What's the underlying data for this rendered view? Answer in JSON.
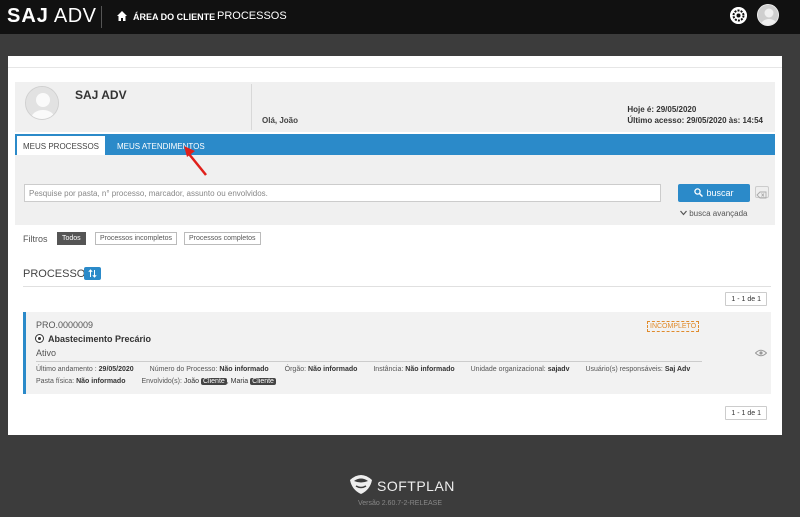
{
  "topbar": {
    "logo_bold": "SAJ",
    "logo_rest": "ADV",
    "area_label": "ÁREA DO CLIENTE",
    "processos_label": "PROCESSOS"
  },
  "header": {
    "client_name": "SAJ ADV",
    "greeting": "Olá, João",
    "today": "Hoje é: 29/05/2020",
    "last_access": "Último acesso: 29/05/2020 às: 14:54"
  },
  "tabs": [
    {
      "label": "MEUS PROCESSOS"
    },
    {
      "label": "MEUS ATENDIMENTOS"
    }
  ],
  "search": {
    "placeholder": "Pesquise por pasta, n° processo, marcador, assunto ou envolvidos.",
    "button_label": "buscar",
    "advanced_label": "busca avançada"
  },
  "filters": {
    "label": "Filtros",
    "chips": [
      "Todos",
      "Processos incompletos",
      "Processos completos"
    ]
  },
  "processos": {
    "title": "PROCESSOS",
    "pager_top": "1 - 1 de 1",
    "pager_bottom": "1 - 1 de 1"
  },
  "process_item": {
    "number": "PRO.0000009",
    "badge": "INCOMPLETO",
    "name": "Abastecimento Precário",
    "status": "Ativo",
    "last_update_label": "Último andamento :",
    "last_update_value": "29/05/2020",
    "process_number_label": "Número do Processo:",
    "process_number_value": "Não informado",
    "orgao_label": "Órgão:",
    "orgao_value": "Não informado",
    "instancia_label": "Instância:",
    "instancia_value": "Não informado",
    "unidade_label": "Unidade organizacional:",
    "unidade_value": "sajadv",
    "responsaveis_label": "Usuário(s) responsáveis:",
    "responsaveis_value": "Saj Adv",
    "pasta_label": "Pasta física:",
    "pasta_value": "Não informado",
    "envolvidos_label": "Envolvido(s):",
    "envolvido1": "João",
    "envolvido1_tag": "Cliente",
    "envolvido2": ", Maria",
    "envolvido2_tag": "Cliente"
  },
  "footer": {
    "brand": "SOFTPLAN",
    "version": "Versão 2.60.7-2-RELEASE"
  },
  "colors": {
    "accent": "#2b8ac9",
    "topbar": "#111111",
    "warning": "#e08b2c",
    "arrow": "#e0201b"
  }
}
